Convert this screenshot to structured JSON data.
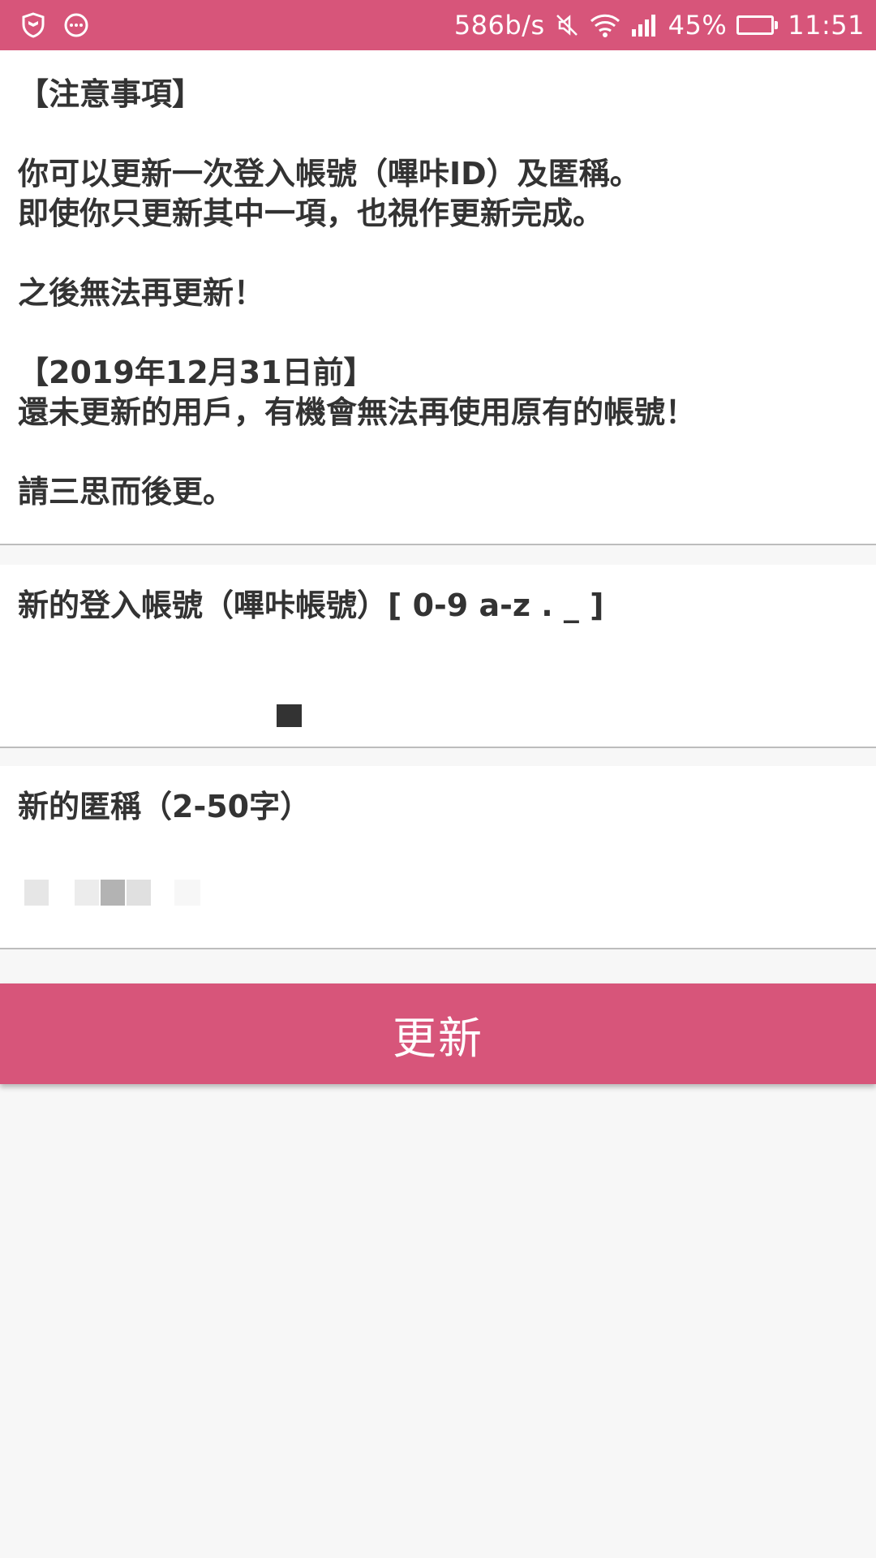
{
  "status_bar": {
    "left_icons": [
      "shield-icon",
      "chat-bubble-icon"
    ],
    "network_speed": "586b/s",
    "battery_percent": "45%",
    "battery_level": 1.0,
    "time": "11:51",
    "accent_color": "#d7557a",
    "battery_color": "#38d64a"
  },
  "notice": {
    "title": "【注意事項】",
    "line1": "你可以更新一次登入帳號（嗶咔ID）及匿稱。",
    "line2": "即使你只更新其中一項，也視作更新完成。",
    "line3": "之後無法再更新！",
    "deadline": "【2019年12月31日前】",
    "line4": "還未更新的用戶，有機會無法再使用原有的帳號！",
    "line5": "請三思而後更。"
  },
  "form": {
    "login_label": "新的登入帳號（嗶咔帳號）[ 0-9 a-z . _ ]",
    "login_value": "",
    "nickname_label": "新的匿稱（2-50字）",
    "nickname_value": ""
  },
  "update_button": {
    "label": "更新"
  }
}
